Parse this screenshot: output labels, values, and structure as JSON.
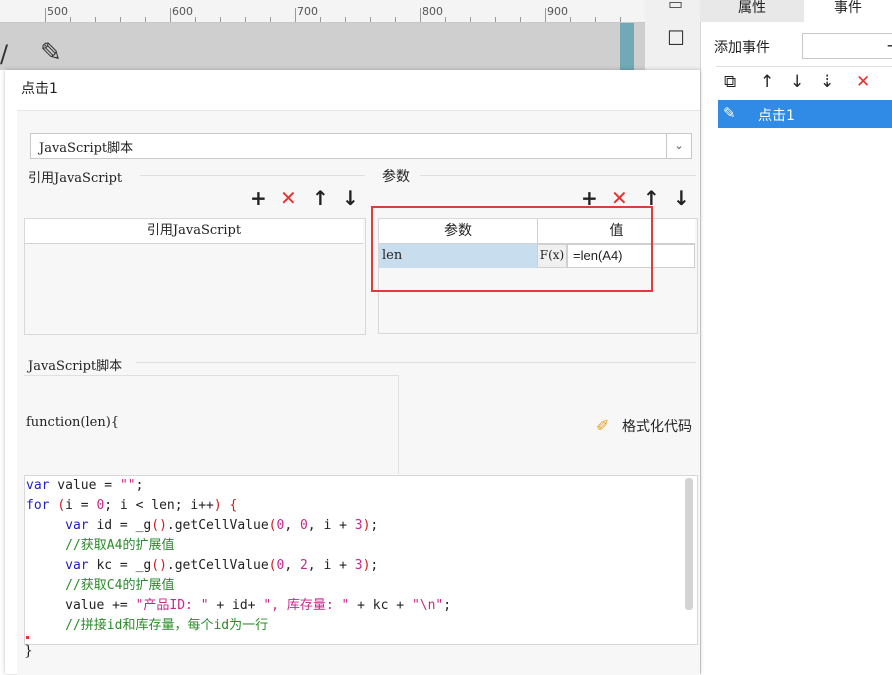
{
  "ruler": {
    "labels": [
      "500",
      "600",
      "700",
      "800",
      "900"
    ]
  },
  "right_panel": {
    "tabs": [
      "属性",
      "事件"
    ],
    "add_event_label": "添加事件",
    "add_event_plus": "+",
    "events": [
      {
        "label": "点击1"
      }
    ]
  },
  "dialog": {
    "title": "点击1",
    "script_type": "JavaScript脚本",
    "ref_js_section": "引用JavaScript",
    "ref_js_column": "引用JavaScript",
    "params_section": "参数",
    "param_columns": [
      "参数",
      "值"
    ],
    "params": [
      {
        "name": "len",
        "fx": "F(x)",
        "value": "=len(A4)"
      }
    ],
    "script_section": "JavaScript脚本",
    "function_header": "function(len){",
    "format_button": "格式化代码",
    "function_close": "}",
    "code_lines": [
      "var value = \"\";",
      "for (i = 0; i < len; i++) {",
      "     var id = _g().getCellValue(0, 0, i + 3);",
      "     //获取A4的扩展值",
      "     var kc = _g().getCellValue(0, 2, i + 3);",
      "     //获取C4的扩展值",
      "     value += \"产品ID: \" + id+ \", 库存量: \" + kc + \"\\n\";",
      "     //拼接id和库存量，每个id为一行"
    ]
  },
  "colors": {
    "accent": "#2f8be6",
    "delete": "#e8312f",
    "highlight": "#e23b3b",
    "keyword": "#2020c8",
    "comment": "#2a8a2a",
    "string": "#c8268c"
  }
}
